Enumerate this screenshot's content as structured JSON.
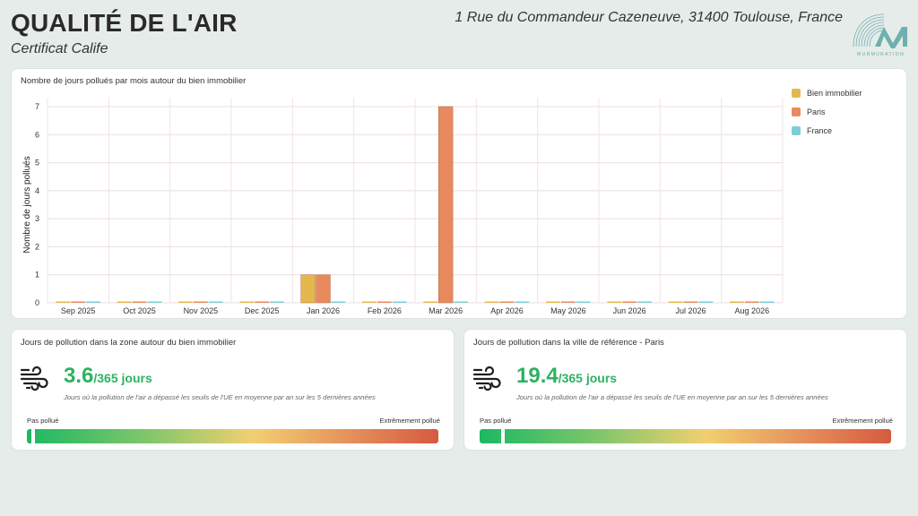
{
  "header": {
    "title": "QUALITÉ DE L'AIR",
    "subtitle": "Certificat Calife",
    "address": "1 Rue du Commandeur Cazeneuve, 31400 Toulouse, France",
    "logo_text": "MURMURATION"
  },
  "chart_data": {
    "type": "bar",
    "title": "Nombre de jours pollués par mois autour du bien immobilier",
    "xlabel": "",
    "ylabel": "Nombre de jours pollués",
    "ylim": [
      0,
      7
    ],
    "yticks": [
      "0",
      "1",
      "2",
      "3",
      "4",
      "5",
      "6",
      "7"
    ],
    "categories": [
      "Sep 2025",
      "Oct 2025",
      "Nov 2025",
      "Dec 2025",
      "Jan 2026",
      "Feb 2026",
      "Mar 2026",
      "Apr 2026",
      "May 2026",
      "Jun 2026",
      "Jul 2026",
      "Aug 2026"
    ],
    "series": [
      {
        "name": "Bien immobilier",
        "color": "#e4b84e",
        "values": [
          0,
          0,
          0,
          0,
          1,
          0,
          0,
          0,
          0,
          0,
          0,
          0
        ]
      },
      {
        "name": "Paris",
        "color": "#e88a5e",
        "values": [
          0,
          0,
          0,
          0,
          1,
          0,
          7,
          0,
          0,
          0,
          0,
          0
        ]
      },
      {
        "name": "France",
        "color": "#7ccfd8",
        "values": [
          0,
          0,
          0,
          0,
          0,
          0,
          0,
          0,
          0,
          0,
          0,
          0
        ]
      }
    ],
    "grid": true,
    "legend_position": "top-right"
  },
  "zone_card": {
    "title": "Jours de pollution dans la zone autour du bien immobilier",
    "value": "3.6",
    "suffix": "/365 jours",
    "description": "Jours où la pollution de l'air a dépassé les seuils de l'UE en moyenne par an sur les 5 dernières années",
    "scale_low": "Pas pollué",
    "scale_high": "Extrêmement pollué",
    "level": 0.01
  },
  "city_card": {
    "title": "Jours de pollution dans la ville de référence - Paris",
    "value": "19.4",
    "suffix": "/365 jours",
    "description": "Jours où la pollution de l'air a dépassé les seuils de l'UE en moyenne par an sur les 5 dernières années",
    "scale_low": "Pas pollué",
    "scale_high": "Extrêmement pollué",
    "level": 0.053
  }
}
